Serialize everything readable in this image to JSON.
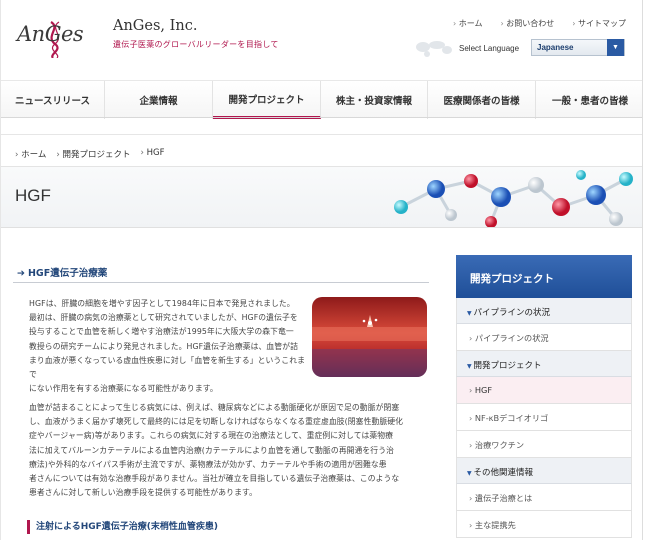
{
  "header": {
    "company": "AnGes, Inc.",
    "tagline": "遺伝子医薬のグローバルリーダーを目指して",
    "logo_text": "AnGes",
    "top_links": [
      "ホーム",
      "お問い合わせ",
      "サイトマップ"
    ],
    "lang_label": "Select Language",
    "lang_value": "Japanese"
  },
  "nav": {
    "items": [
      "ニュースリリース",
      "企業情報",
      "開発プロジェクト",
      "株主・投資家情報",
      "医療関係者の皆様",
      "一般・患者の皆様"
    ],
    "active_index": 2
  },
  "breadcrumb": [
    "ホーム",
    "開発プロジェクト",
    "HGF"
  ],
  "page_title": "HGF",
  "main": {
    "section_title": "HGF遺伝子治療薬",
    "p1_lines": [
      "HGFは、肝臓の細胞を増やす因子として1984年に日本で発見されました。",
      "最初は、肝臓の病気の治療薬として研究されていましたが、HGFの遺伝子を",
      "投与することで血管を新しく増やす治療法が1995年に大阪大学の森下竜一",
      "教授らの研究チームにより発見されました。HGF遺伝子治療薬は、血管が詰",
      "まり血液が悪くなっている虚血性疾患に対し「血管を新生する」というこれまで",
      "にない作用を有する治療薬になる可能性があります。"
    ],
    "p2_lines": [
      "血管が詰まることによって生じる病気には、例えば、糖尿病などによる動脈硬化が原因で足の動脈が閉塞",
      "し、血液がうまく届かず壊死して最終的には足を切断しなければならなくなる重症虚血肢(閉塞性動脈硬化",
      "症やバージャー病)等があります。これらの病気に対する現在の治療法として、重症例に対しては薬物療",
      "法に加えてバルーンカテーテルによる血管内治療(カテーテルにより血管を通して動脈の再開通を行う治",
      "療法)や外科的なバイパス手術が主流ですが、薬物療法が効かず、カテーテルや手術の適用が困難な患",
      "者さんについては有効な治療手段がありません。当社が確立を目指している遺伝子治療薬は、このような",
      "患者さんに対して新しい治療手段を提供する可能性があります。"
    ],
    "sub_heading": "注射によるHGF遺伝子治療(末梢性血管疾患)"
  },
  "sidebar": {
    "title": "開発プロジェクト",
    "groups": [
      {
        "label": "パイプラインの状況",
        "items": [
          "パイプラインの状況"
        ]
      },
      {
        "label": "開発プロジェクト",
        "items": [
          "HGF",
          "NF-κBデコイオリゴ",
          "治療ワクチン"
        ]
      },
      {
        "label": "その他関連情報",
        "items": [
          "遺伝子治療とは",
          "主な提携先"
        ]
      }
    ],
    "current_item": "HGF"
  },
  "colors": {
    "accent": "#b0174e",
    "navy": "#23477a",
    "sidebar_head": "#2a5aa3"
  }
}
